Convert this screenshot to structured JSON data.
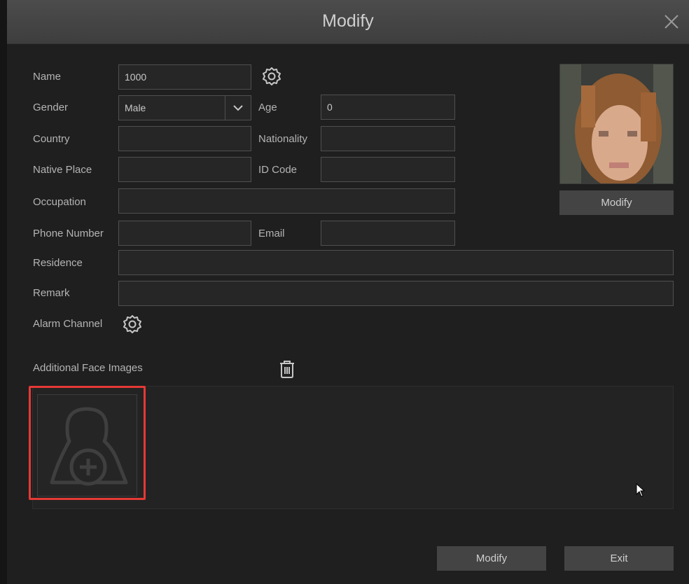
{
  "dialog": {
    "title": "Modify"
  },
  "form": {
    "name": {
      "label": "Name",
      "value": "1000"
    },
    "gender": {
      "label": "Gender",
      "value": "Male"
    },
    "age": {
      "label": "Age",
      "value": "0"
    },
    "country": {
      "label": "Country",
      "value": ""
    },
    "nationality": {
      "label": "Nationality",
      "value": ""
    },
    "native_place": {
      "label": "Native Place",
      "value": ""
    },
    "id_code": {
      "label": "ID Code",
      "value": ""
    },
    "occupation": {
      "label": "Occupation",
      "value": ""
    },
    "phone_number": {
      "label": "Phone Number",
      "value": ""
    },
    "email": {
      "label": "Email",
      "value": ""
    },
    "residence": {
      "label": "Residence",
      "value": ""
    },
    "remark": {
      "label": "Remark",
      "value": ""
    },
    "alarm_channel": {
      "label": "Alarm Channel"
    }
  },
  "photo": {
    "modify_label": "Modify"
  },
  "additional": {
    "label": "Additional Face Images"
  },
  "footer": {
    "modify_label": "Modify",
    "exit_label": "Exit"
  },
  "icons": {
    "settings": "gear-icon",
    "close": "close-icon",
    "delete": "trash-icon",
    "add_face": "add-person-icon",
    "dropdown": "chevron-down-icon"
  },
  "colors": {
    "background": "#1f1f1f",
    "titlebar": "#444444",
    "button": "#444444",
    "highlight": "#e53935"
  }
}
